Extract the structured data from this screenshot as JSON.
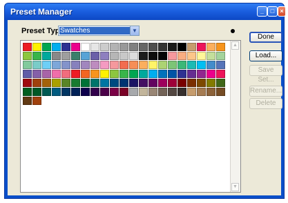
{
  "window": {
    "title": "Preset Manager"
  },
  "title_buttons": {
    "minimize": "_",
    "maximize": "□",
    "close": "×"
  },
  "preset_type": {
    "label": "Preset Type:",
    "value": "Swatches"
  },
  "buttons": {
    "done": "Done",
    "load": "Load...",
    "save": "Save Set...",
    "rename": "Rename...",
    "delete": "Delete"
  },
  "swatches": [
    "#ed1c24",
    "#fff200",
    "#00a651",
    "#00aeef",
    "#2e3192",
    "#ec008c",
    "#ffffff",
    "#e6e6e6",
    "#cccccc",
    "#b3b3b3",
    "#999999",
    "#808080",
    "#666666",
    "#4d4d4d",
    "#333333",
    "#1a1a1a",
    "#000000",
    "#c69c6d",
    "#ed145b",
    "#fbaf5d",
    "#f7941d",
    "#8dc63f",
    "#39b54a",
    "#00a99d",
    "#898989",
    "#9e9e9e",
    "#3a7f6b",
    "#57a3d6",
    "#6b5fa8",
    "#8e7fbf",
    "#b6b6b6",
    "#c8c8c8",
    "#dcdcdc",
    "#1c1c1c",
    "#0d0d0d",
    "#050505",
    "#f6989d",
    "#f9ad81",
    "#fdc689",
    "#fff799",
    "#c4df9b",
    "#a3d39c",
    "#82ca9c",
    "#7accc8",
    "#6dcff6",
    "#7da7d9",
    "#8393ca",
    "#8781bd",
    "#a186be",
    "#bd8cbf",
    "#f49ac1",
    "#f5989d",
    "#f26c4f",
    "#f68e56",
    "#fbaf5d",
    "#fff467",
    "#acd373",
    "#7cc576",
    "#3cb878",
    "#1cbbb4",
    "#00bff3",
    "#448ccb",
    "#5674b9",
    "#605ca8",
    "#8560a8",
    "#a864a8",
    "#f06eaa",
    "#f26d7d",
    "#ed1c24",
    "#f26522",
    "#f7941d",
    "#fff200",
    "#8dc63f",
    "#39b54a",
    "#00a651",
    "#00a99d",
    "#00aeef",
    "#0072bc",
    "#0054a6",
    "#2e3192",
    "#662d91",
    "#92278f",
    "#ec008c",
    "#ed145b",
    "#9e0b0f",
    "#a0410d",
    "#a3620a",
    "#aba000",
    "#598527",
    "#197b30",
    "#007236",
    "#00746b",
    "#0076a3",
    "#004a80",
    "#003471",
    "#1b1464",
    "#440e62",
    "#630460",
    "#9e005d",
    "#9e0039",
    "#790000",
    "#7b2e00",
    "#7d4900",
    "#827b00",
    "#406618",
    "#005e20",
    "#005826",
    "#005952",
    "#005b7f",
    "#003663",
    "#002157",
    "#0d004c",
    "#32004b",
    "#4b0049",
    "#7b0046",
    "#7a0026",
    "#a7a9ac",
    "#c2b59b",
    "#998675",
    "#736357",
    "#534741",
    "#362f2d",
    "#c69c6d",
    "#a67c52",
    "#8c6239",
    "#754c24",
    "#603913",
    "#a0410d"
  ]
}
